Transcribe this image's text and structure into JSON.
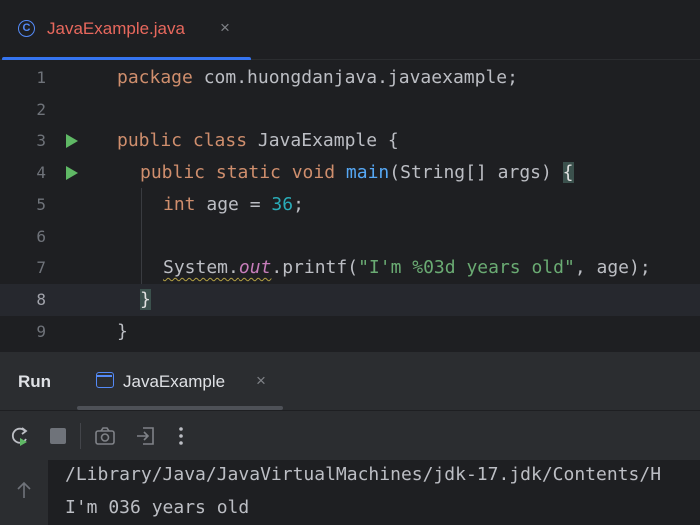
{
  "editor_tab": {
    "label": "JavaExample.java",
    "close": "×",
    "icon": "java-class-icon"
  },
  "lines": [
    {
      "n": "1"
    },
    {
      "n": "2"
    },
    {
      "n": "3"
    },
    {
      "n": "4"
    },
    {
      "n": "5"
    },
    {
      "n": "6"
    },
    {
      "n": "7"
    },
    {
      "n": "8"
    },
    {
      "n": "9"
    }
  ],
  "code": {
    "l1_kw": "package",
    "l1_rest": " com.huongdanjava.javaexample;",
    "l3_kw": "public class",
    "l3_rest": " JavaExample {",
    "l4_kw": "public static void",
    "l4_sp": " ",
    "l4_fn": "main",
    "l4_args": "(String[] args) ",
    "l4_brace": "{",
    "l5_kw": "int",
    "l5_a": " age = ",
    "l5_num": "36",
    "l5_b": ";",
    "l7_sys": "System.",
    "l7_out": "out",
    "l7_call": ".printf(",
    "l7_str": "\"I'm %03d years old\"",
    "l7_end": ", age);",
    "l8_brace": "}",
    "l9_brace": "}"
  },
  "run_panel": {
    "title": "Run",
    "tab_label": "JavaExample",
    "tab_close": "×"
  },
  "console": {
    "line1": "/Library/Java/JavaVirtualMachines/jdk-17.jdk/Contents/H",
    "line2": "I'm 036 years old"
  },
  "colors": {
    "accent": "#3574f0",
    "tab_text": "#e8685d",
    "run_green": "#5fb865"
  }
}
